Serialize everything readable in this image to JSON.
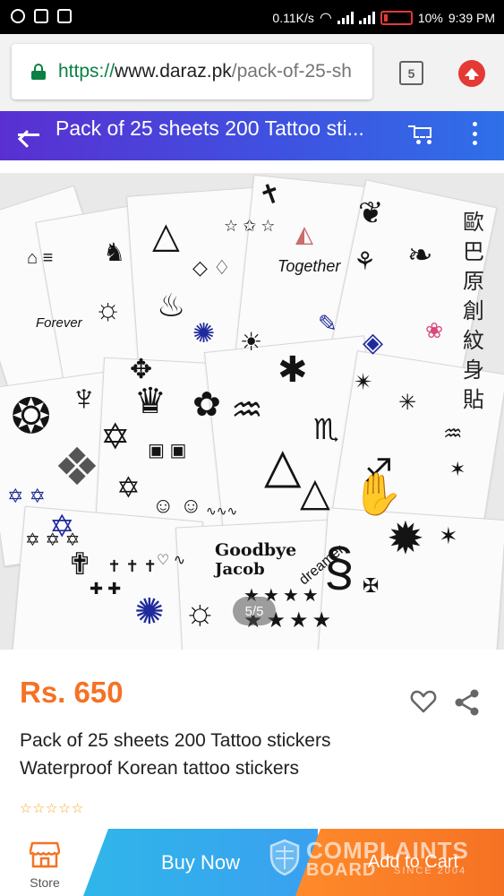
{
  "status_bar": {
    "network_speed": "0.11K/s",
    "battery": "10%",
    "time": "9:39 PM",
    "battery_color": "#e53935"
  },
  "browser": {
    "url_scheme": "https://",
    "url_host": "www.daraz.pk",
    "url_path": "/pack-of-25-sh",
    "tab_count": "5",
    "lock_color": "#0b8043"
  },
  "app_bar": {
    "title": "Pack of 25 sheets 200 Tattoo sti...",
    "back_icon": "back-arrow-icon",
    "cart_icon": "cart-icon",
    "more_icon": "more-vert-icon"
  },
  "gallery": {
    "counter": "5/5",
    "image_side_text": [
      "歐",
      "巴",
      "原",
      "創",
      "紋",
      "身",
      "貼"
    ],
    "tattoo_text_1": "Together",
    "tattoo_text_2": "Forever",
    "tattoo_text_3": "Goodbye",
    "tattoo_text_4": "Jacob",
    "tattoo_text_5": "dreamer"
  },
  "product": {
    "price": "Rs. 650",
    "title_line1": "Pack of 25 sheets 200 Tattoo stickers",
    "title_line2": "Waterproof Korean tattoo stickers",
    "rating_stars": [
      "☆",
      "☆",
      "☆",
      "☆",
      "☆"
    ],
    "accent_color": "#f57224"
  },
  "bottom_bar": {
    "store_label": "Store",
    "buy_now_label": "Buy Now",
    "add_to_cart_label": "Add to Cart"
  },
  "watermark": {
    "line1": "COMPLAINTS",
    "line2": "BOARD",
    "since": "SINCE 2004"
  }
}
